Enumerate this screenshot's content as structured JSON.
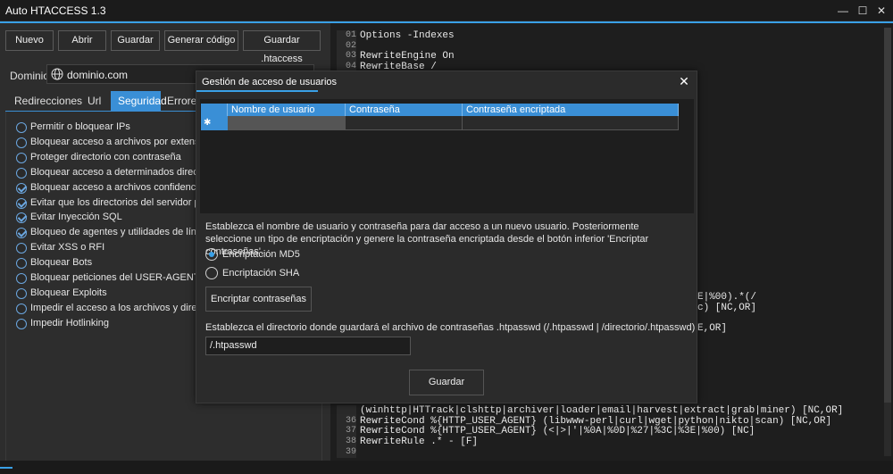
{
  "window": {
    "title": "Auto HTACCESS 1.3",
    "minimize": "—",
    "maximize": "☐",
    "close": "✕"
  },
  "toolbar": {
    "new_label": "Nuevo",
    "open_label": "Abrir",
    "save_label": "Guardar",
    "generate_label": "Generar código",
    "save_htaccess_label": "Guardar .htaccess"
  },
  "domain": {
    "label": "Dominio",
    "value": "dominio.com"
  },
  "tabs": [
    {
      "label": "Redirecciones"
    },
    {
      "label": "Url"
    },
    {
      "label": "Seguridad"
    },
    {
      "label": "Errores"
    }
  ],
  "security_options": [
    {
      "label": "Permitir o bloquear IPs",
      "checked": false
    },
    {
      "label": "Bloquear acceso a archivos por extensión",
      "checked": false
    },
    {
      "label": "Proteger directorio con contraseña",
      "checked": false
    },
    {
      "label": "Bloquear acceso a determinados directorios",
      "checked": false
    },
    {
      "label": "Bloquear acceso a archivos confidenciales",
      "checked": true
    },
    {
      "label": "Evitar que los directorios del servidor puedan s",
      "checked": true
    },
    {
      "label": "Evitar Inyección SQL",
      "checked": true
    },
    {
      "label": "Bloqueo de agentes y utilidades de línea de co",
      "checked": true
    },
    {
      "label": "Evitar XSS o RFI",
      "checked": false
    },
    {
      "label": "Bloquear Bots",
      "checked": false
    },
    {
      "label": "Bloquear peticiones del USER-AGENT",
      "checked": false
    },
    {
      "label": "Bloquear Exploits",
      "checked": false
    },
    {
      "label": "Impedir el acceso a los archivos y directorios c",
      "checked": false
    },
    {
      "label": "Impedir Hotlinking",
      "checked": false
    }
  ],
  "editor": {
    "top_lines": [
      {
        "n": "01",
        "code": "Options -Indexes"
      },
      {
        "n": "02",
        "code": ""
      },
      {
        "n": "03",
        "code": "RewriteEngine On"
      },
      {
        "n": "04",
        "code": "RewriteBase /"
      }
    ],
    "right_fragments": [
      "E|%00).*(/",
      "c) [NC,OR]",
      "E,OR]"
    ],
    "bottom_lines": [
      {
        "n": "",
        "code": "(winhttp|HTTrack|clshttp|archiver|loader|email|harvest|extract|grab|miner) [NC,OR]"
      },
      {
        "n": "36",
        "code": "RewriteCond %{HTTP_USER_AGENT} (libwww-perl|curl|wget|python|nikto|scan) [NC,OR]"
      },
      {
        "n": "37",
        "code": "RewriteCond %{HTTP_USER_AGENT} (<|>|'|%0A|%0D|%27|%3C|%3E|%00) [NC]"
      },
      {
        "n": "38",
        "code": "RewriteRule .* - [F]"
      },
      {
        "n": "39",
        "code": ""
      }
    ]
  },
  "dialog": {
    "title": "Gestión de acceso de usuarios",
    "close": "✕",
    "grid": {
      "columns": [
        "Nombre de usuario",
        "Contraseña",
        "Contraseña encriptada"
      ],
      "row_marker": "✱"
    },
    "info_text": "Establezca el nombre de usuario y contraseña para dar acceso a un nuevo usuario. Posteriormente seleccione un tipo de encriptación y genere la contraseña encriptada desde el botón inferior 'Encriptar contraseñas'.",
    "radio_md5": "Encriptación MD5",
    "radio_sha": "Encriptación SHA",
    "selected": "md5",
    "encrypt_label": "Encriptar contraseñas",
    "path_label": "Establezca el directorio donde guardará el archivo de contraseñas .htpasswd (/.htpasswd | /directorio/.htpasswd)",
    "path_value": "/.htpasswd",
    "save_label": "Guardar"
  },
  "colors": {
    "accent": "#3a8fd6",
    "background": "#1e1e1e",
    "panel": "#2d2d2d"
  }
}
